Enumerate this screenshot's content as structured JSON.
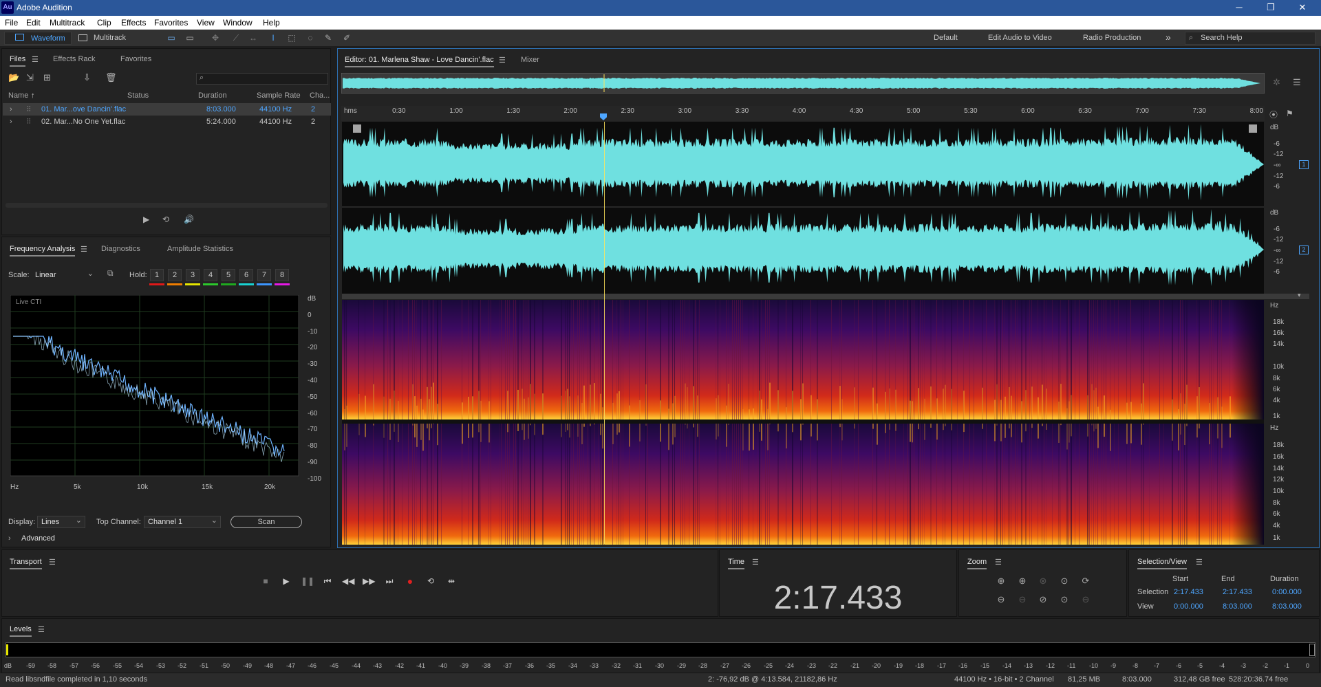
{
  "app": {
    "icon_text": "Au",
    "title": "Adobe Audition"
  },
  "menu": [
    "File",
    "Edit",
    "Multitrack",
    "Clip",
    "Effects",
    "Favorites",
    "View",
    "Window",
    "Help"
  ],
  "toolbar": {
    "waveform": "Waveform",
    "multitrack": "Multitrack",
    "workspaces": [
      "Default",
      "Edit Audio to Video",
      "Radio Production"
    ],
    "search": "Search Help"
  },
  "files": {
    "tabs": [
      "Files",
      "Effects Rack",
      "Favorites"
    ],
    "search_placeholder": "",
    "columns": [
      "Name",
      "Status",
      "Duration",
      "Sample Rate",
      "Cha..."
    ],
    "rows": [
      {
        "name": "01. Mar...ove Dancin'.flac",
        "duration": "8:03.000",
        "rate": "44100 Hz",
        "ch": "2",
        "selected": true
      },
      {
        "name": "02. Mar...No One Yet.flac",
        "duration": "5:24.000",
        "rate": "44100 Hz",
        "ch": "2",
        "selected": false
      }
    ]
  },
  "analysis": {
    "tabs": [
      "Frequency Analysis",
      "Diagnostics",
      "Amplitude Statistics"
    ],
    "scale_label": "Scale:",
    "scale_value": "Linear",
    "hold_label": "Hold:",
    "hold": [
      "1",
      "2",
      "3",
      "4",
      "5",
      "6",
      "7",
      "8"
    ],
    "hold_colors": [
      "#e01919",
      "#f07d00",
      "#e6e600",
      "#2cc82c",
      "#1faa1f",
      "#19d2d2",
      "#3c96ff",
      "#e619e6"
    ],
    "graph_label": "Live CTI",
    "db_ticks": [
      "dB",
      "0",
      "-10",
      "-20",
      "-30",
      "-40",
      "-50",
      "-60",
      "-70",
      "-80",
      "-90",
      "-100"
    ],
    "hz_ticks": [
      "Hz",
      "5k",
      "10k",
      "15k",
      "20k"
    ],
    "display_label": "Display:",
    "display_value": "Lines",
    "top_channel_label": "Top Channel:",
    "top_channel_value": "Channel 1",
    "scan": "Scan",
    "advanced": "Advanced"
  },
  "editor": {
    "tabs": [
      "Editor: 01. Marlena Shaw - Love Dancin'.flac",
      "Mixer"
    ],
    "time_ticks": [
      "hms",
      "0:30",
      "1:00",
      "1:30",
      "2:00",
      "2:30",
      "3:00",
      "3:30",
      "4:00",
      "4:30",
      "5:00",
      "5:30",
      "6:00",
      "6:30",
      "7:00",
      "7:30",
      "8:00"
    ],
    "db_ticks": [
      "dB",
      "-6",
      "-12",
      "-∞",
      "-12",
      "-6"
    ],
    "hz_ticks_top": [
      "Hz",
      "18k",
      "16k",
      "14k",
      "10k",
      "8k",
      "6k",
      "4k",
      "1k"
    ],
    "hz_ticks_bottom": [
      "Hz",
      "18k",
      "16k",
      "14k",
      "12k",
      "10k",
      "8k",
      "6k",
      "4k",
      "1k"
    ],
    "ch1": "1",
    "ch2": "2",
    "waveform_color": "#6fe0e0"
  },
  "transport": {
    "title": "Transport"
  },
  "time": {
    "title": "Time",
    "value": "2:17.433"
  },
  "zoom": {
    "title": "Zoom"
  },
  "selection": {
    "title": "Selection/View",
    "headers": [
      "Start",
      "End",
      "Duration"
    ],
    "selection_label": "Selection",
    "selection": [
      "2:17.433",
      "2:17.433",
      "0:00.000"
    ],
    "view_label": "View",
    "view": [
      "0:00.000",
      "8:03.000",
      "8:03.000"
    ]
  },
  "levels": {
    "title": "Levels",
    "ticks": [
      "dB",
      "-59",
      "-58",
      "-57",
      "-56",
      "-55",
      "-54",
      "-53",
      "-52",
      "-51",
      "-50",
      "-49",
      "-48",
      "-47",
      "-46",
      "-45",
      "-44",
      "-43",
      "-42",
      "-41",
      "-40",
      "-39",
      "-38",
      "-37",
      "-36",
      "-35",
      "-34",
      "-33",
      "-32",
      "-31",
      "-30",
      "-29",
      "-28",
      "-27",
      "-26",
      "-25",
      "-24",
      "-23",
      "-22",
      "-21",
      "-20",
      "-19",
      "-18",
      "-17",
      "-16",
      "-15",
      "-14",
      "-13",
      "-12",
      "-11",
      "-10",
      "-9",
      "-8",
      "-7",
      "-6",
      "-5",
      "-4",
      "-3",
      "-2",
      "-1",
      "0"
    ]
  },
  "status": {
    "left": "Read libsndfile completed in 1,10 seconds",
    "cursor": "2: -76,92 dB @ 4:13.584, 21182,86 Hz",
    "format": "44100 Hz • 16-bit • 2 Channel",
    "size": "81,25 MB",
    "duration": "8:03.000",
    "free": "312,48 GB free",
    "free_time": "528:20:36.74 free"
  }
}
